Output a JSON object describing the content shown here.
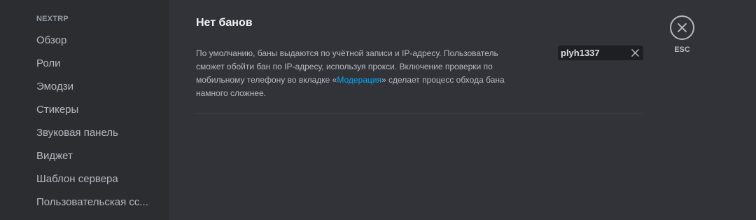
{
  "sidebar": {
    "header": "NEXTRP",
    "items": [
      {
        "label": "Обзор"
      },
      {
        "label": "Роли"
      },
      {
        "label": "Эмодзи"
      },
      {
        "label": "Стикеры"
      },
      {
        "label": "Звуковая панель"
      },
      {
        "label": "Виджет"
      },
      {
        "label": "Шаблон сервера"
      },
      {
        "label": "Пользовательская сс..."
      }
    ]
  },
  "main": {
    "title": "Нет банов",
    "description": {
      "line1": "По умолчанию, баны выдаются по учётной записи и IP-адресу. Пользователь",
      "line2": "сможет обойти бан по IP-адресу, используя прокси. Включение проверки по",
      "line3_before": "мобильному телефону во вкладке «",
      "link": "Модерация",
      "line3_after": "» сделает процесс обхода бана",
      "line4": "намного сложнее."
    }
  },
  "search": {
    "value": "plyh1337",
    "clear_icon": "close-icon"
  },
  "close": {
    "icon": "close-circle-icon",
    "label": "ESC"
  },
  "colors": {
    "background": "#313338",
    "sidebar": "#2b2d31",
    "link": "#00a8fc",
    "input_bg": "#1e1f22"
  }
}
